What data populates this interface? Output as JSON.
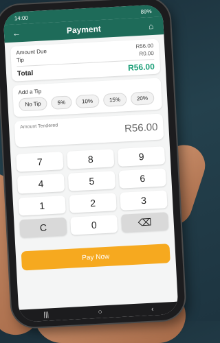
{
  "status": {
    "time": "14:00",
    "battery": "89%"
  },
  "header": {
    "title": "Payment"
  },
  "summary": {
    "amount_due_label": "Amount Due",
    "amount_due_value": "R56.00",
    "tip_label": "Tip",
    "tip_value": "R0.00",
    "total_label": "Total",
    "total_value": "R56.00"
  },
  "tip": {
    "heading": "Add a Tip",
    "options": [
      "No Tip",
      "5%",
      "10%",
      "15%",
      "20%"
    ]
  },
  "tender": {
    "label": "Amount Tendered",
    "value": "R56.00"
  },
  "keypad": {
    "keys": [
      "7",
      "8",
      "9",
      "4",
      "5",
      "6",
      "1",
      "2",
      "3",
      "C",
      "0"
    ]
  },
  "pay": {
    "label": "Pay Now"
  },
  "colors": {
    "primary": "#1e6b59",
    "accent": "#f6a91f",
    "total_green": "#1ea07a"
  }
}
